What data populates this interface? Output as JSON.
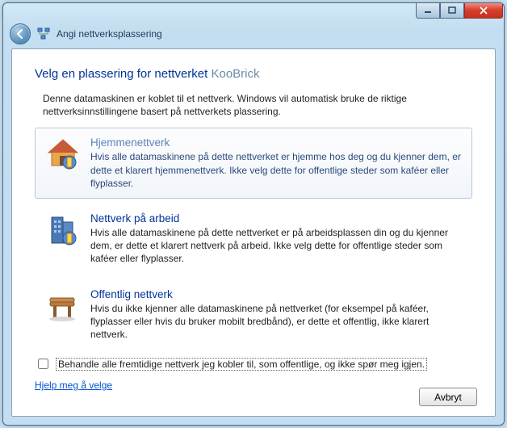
{
  "window": {
    "back_tooltip": "Tilbake",
    "title": "Angi nettverksplassering"
  },
  "heading": {
    "prefix": "Velg en plassering for nettverket ",
    "network_name": "KooBrick"
  },
  "intro": "Denne datamaskinen er koblet til et nettverk. Windows vil automatisk bruke de riktige nettverksinnstillingene basert på nettverkets plassering.",
  "options": {
    "home": {
      "title": "Hjemmenettverk",
      "desc": "Hvis alle datamaskinene på dette nettverket er hjemme hos deg og du kjenner dem, er dette et klarert hjemmenettverk. Ikke velg dette for offentlige steder som kaféer eller flyplasser."
    },
    "work": {
      "title": "Nettverk på arbeid",
      "desc": "Hvis alle datamaskinene på dette nettverket er på arbeidsplassen din og du kjenner dem, er dette et klarert nettverk på arbeid. Ikke velg dette for offentlige steder som kaféer eller flyplasser."
    },
    "public": {
      "title": "Offentlig nettverk",
      "desc": "Hvis du ikke kjenner alle datamaskinene på nettverket (for eksempel på kaféer, flyplasser eller hvis du bruker mobilt bredbånd), er dette et offentlig, ikke klarert nettverk."
    }
  },
  "checkbox": {
    "label": "Behandle alle fremtidige nettverk jeg kobler til, som offentlige, og ikke spør meg igjen.",
    "checked": false
  },
  "help_link": "Hjelp meg å velge",
  "buttons": {
    "cancel": "Avbryt"
  }
}
